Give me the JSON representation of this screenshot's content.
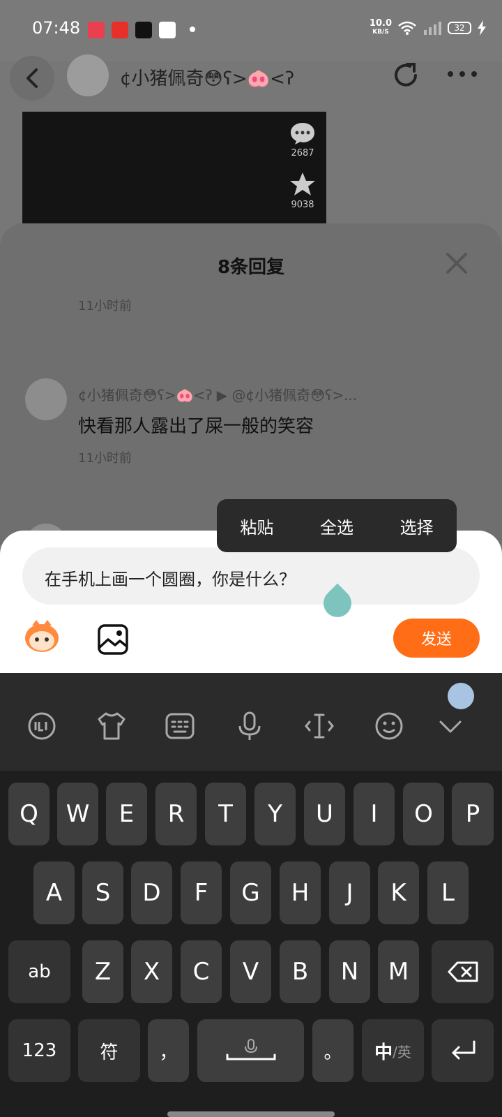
{
  "status_bar": {
    "time": "07:48",
    "speed_value": "10.0",
    "speed_unit": "KB/S",
    "battery": "32"
  },
  "header": {
    "title": "¢小猪佩奇😳ʕ>🐽<ʔ"
  },
  "video": {
    "comment_count": "2687",
    "star_count": "9038"
  },
  "sheet": {
    "title": "8条回复",
    "time_top": "11小时前",
    "reply": {
      "user": "¢小猪佩奇😳ʕ>🐽<ʔ ▶ @¢小猪佩奇😳ʕ>...",
      "text": "快看那人露出了屎一般的笑容",
      "time": "11小时前"
    }
  },
  "context_menu": {
    "paste": "粘贴",
    "select_all": "全选",
    "select": "选择"
  },
  "input": {
    "value": "在手机上画一个圆圈，你是什么？",
    "send_label": "发送"
  },
  "keyboard": {
    "row1": [
      "Q",
      "W",
      "E",
      "R",
      "T",
      "Y",
      "U",
      "I",
      "O",
      "P"
    ],
    "row2": [
      "A",
      "S",
      "D",
      "F",
      "G",
      "H",
      "J",
      "K",
      "L"
    ],
    "row3": [
      "Z",
      "X",
      "C",
      "V",
      "B",
      "N",
      "M"
    ],
    "ab": "ab",
    "num": "123",
    "symbol": "符",
    "comma": "，",
    "period": "。",
    "lang_main": "中",
    "lang_sub": "/英"
  },
  "colors": {
    "accent": "#ff6e17",
    "cursor": "#7cc4bd"
  }
}
